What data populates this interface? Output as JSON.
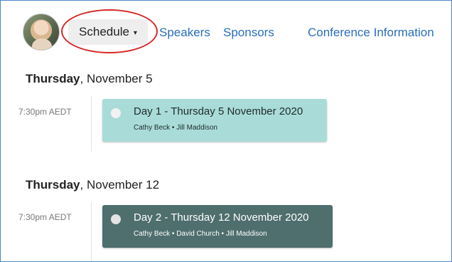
{
  "nav": {
    "schedule_label": "Schedule",
    "caret_glyph": "▾",
    "links": [
      "Speakers",
      "Sponsors",
      "Conference Information"
    ]
  },
  "days": [
    {
      "weekday": "Thursday",
      "date": ", November 5",
      "events": [
        {
          "time": "7:30pm AEDT",
          "title": "Day 1 - Thursday 5 November 2020",
          "people": "Cathy Beck • Jill Maddison",
          "color": "#a9dcd9"
        }
      ]
    },
    {
      "weekday": "Thursday",
      "date": ", November 12",
      "events": [
        {
          "time": "7:30pm AEDT",
          "title": "Day 2 - Thursday 12 November 2020",
          "people": "Cathy Beck • David Church • Jill Maddison",
          "color": "#4f6e6e"
        }
      ]
    }
  ],
  "colors": {
    "link": "#2a6ebb",
    "highlight": "#d62828",
    "frame_border": "#4a86c8"
  }
}
